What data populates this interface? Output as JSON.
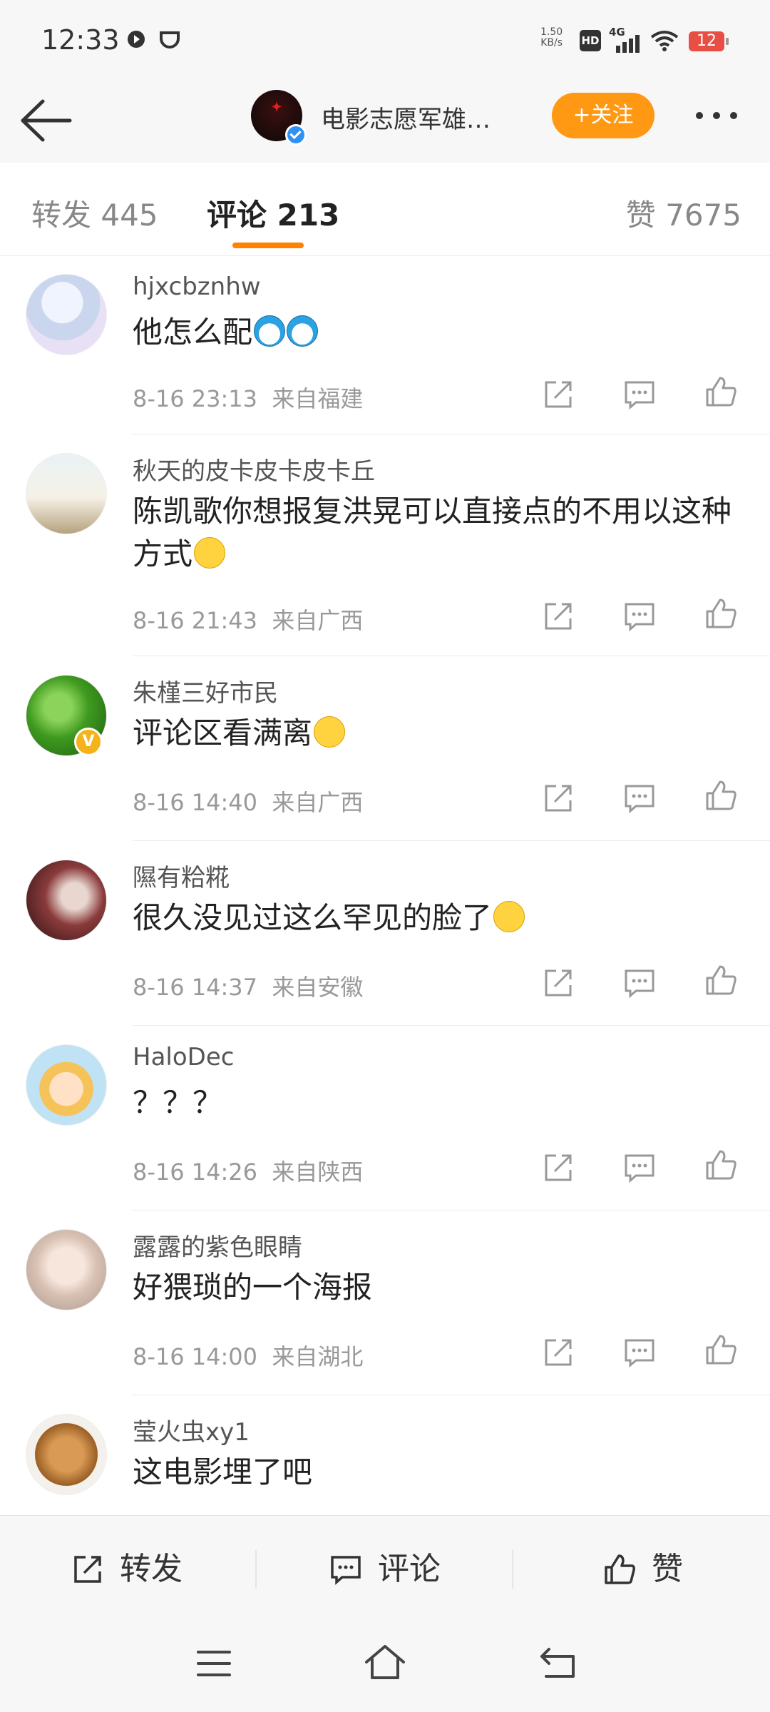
{
  "status_bar": {
    "time": "12:33",
    "net_speed_value": "1.50",
    "net_speed_unit": "KB/s",
    "hd": "HD",
    "network": "4G",
    "battery": "12"
  },
  "header": {
    "title": "电影志愿军雄…",
    "follow_label": "+关注"
  },
  "tabs": {
    "repost": "转发 445",
    "comment": "评论 213",
    "like": "赞 7675"
  },
  "comments": [
    {
      "username": "hjxcbznhw",
      "text": "他怎么配",
      "emoji": [
        "doraemon",
        "doraemon"
      ],
      "time": "8-16 23:13",
      "location": "来自福建"
    },
    {
      "username": "秋天的皮卡皮卡皮卡丘",
      "text": "陈凯歌你想报复洪晃可以直接点的不用以这种方式",
      "emoji": [
        "eye-roll"
      ],
      "time": "8-16 21:43",
      "location": "来自广西"
    },
    {
      "username": "朱槿三好市民",
      "text": "评论区看满离",
      "emoji": [
        "smile"
      ],
      "time": "8-16 14:40",
      "location": "来自广西"
    },
    {
      "username": "隰有粭糀",
      "text": "很久没见过这么罕见的脸了",
      "emoji": [
        "sad"
      ],
      "time": "8-16 14:37",
      "location": "来自安徽"
    },
    {
      "username": "HaloDec",
      "text": "？？？",
      "emoji": [],
      "time": "8-16 14:26",
      "location": "来自陕西"
    },
    {
      "username": "露露的紫色眼睛",
      "text": "好猥琐的一个海报",
      "emoji": [],
      "time": "8-16 14:00",
      "location": "来自湖北"
    },
    {
      "username": "莹火虫xy1",
      "text": "这电影埋了吧",
      "emoji": [],
      "time": "",
      "location": ""
    }
  ],
  "bottom_bar": {
    "repost_label": "转发",
    "comment_label": "评论",
    "like_label": "赞"
  },
  "colors": {
    "accent": "#ff8200",
    "follow_button": "#ff9812",
    "verified": "#2e92f5",
    "vip_badge": "#f5b31b"
  }
}
